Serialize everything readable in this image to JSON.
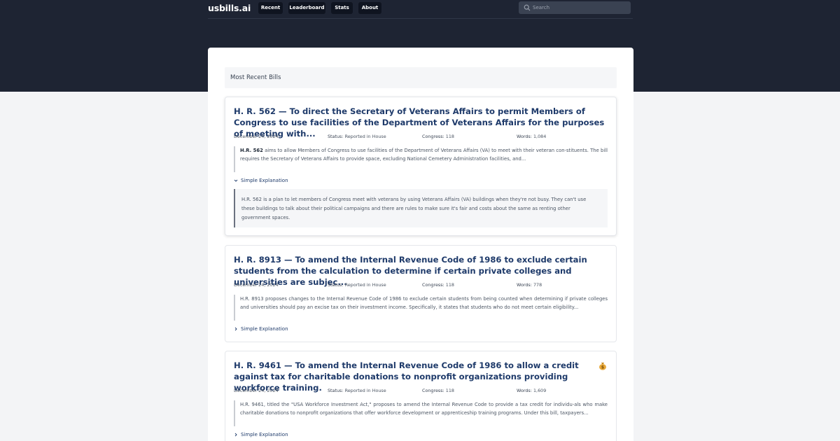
{
  "header": {
    "brand": "usbills.ai",
    "nav": [
      {
        "label": "Recent"
      },
      {
        "label": "Leaderboard"
      },
      {
        "label": "Stats"
      },
      {
        "label": "About"
      }
    ],
    "search_placeholder": "Search"
  },
  "main": {
    "section_title": "Most Recent Bills",
    "bills": [
      {
        "title": "H. R. 562 — To direct the Secretary of Veterans Affairs to permit Members of Congress to use facilities of the Department of Veterans Affairs for the purposes of meeting with...",
        "date": "December 24, 2024",
        "status_label": "Status:",
        "status": "Reported in House",
        "congress_label": "Congress:",
        "congress": "118",
        "words_label": "Words:",
        "words": "1,084",
        "summary_lead": "H.R. 562",
        "summary_rest": " aims to allow Members of Congress to use facilities of the Department of Veterans Affairs (VA) to meet with their veteran con-stituents. The bill requires the Secretary of Veterans Affairs to provide space, excluding National Cemetery Administration facilities, and...",
        "toggle_label": "Simple Explanation",
        "expanded": true,
        "explanation": "H.R. 562 is a plan to let members of Congress meet with veterans by using Veterans Affairs (VA) buildings when they're not busy. They can't use these buildings to talk about their political campaigns and there are rules to make sure it's fair and costs about the same as renting other government spaces."
      },
      {
        "title": "H. R. 8913 — To amend the Internal Revenue Code of 1986 to exclude certain students from the calculation to determine if certain private colleges and universities are subjec...",
        "date": "December 24, 2024",
        "status_label": "Status:",
        "status": "Reported in House",
        "congress_label": "Congress:",
        "congress": "118",
        "words_label": "Words:",
        "words": "778",
        "summary_lead": "",
        "summary_rest": "H.R. 8913 proposes changes to the Internal Revenue Code of 1986 to exclude certain students from being counted when determining if private colleges and universities should pay an excise tax on their investment income. Specifically, it states that students who do not meet certain eligibility...",
        "toggle_label": "Simple Explanation",
        "expanded": false
      },
      {
        "title": "H. R. 9461 — To amend the Internal Revenue Code of 1986 to allow a credit against tax for charitable donations to nonprofit organizations providing workforce training.",
        "date": "December 24, 2024",
        "status_label": "Status:",
        "status": "Reported in House",
        "congress_label": "Congress:",
        "congress": "118",
        "words_label": "Words:",
        "words": "1,609",
        "summary_lead": "",
        "summary_rest": "H.R. 9461, titled the \"USA Workforce Investment Act,\" proposes to amend the Internal Revenue Code to provide a tax credit for individu-als who make charitable donations to nonprofit organizations that offer workforce development or apprenticeship training programs. Under this bill, taxpayers...",
        "toggle_label": "Simple Explanation",
        "expanded": false,
        "icon": "money-bag-icon"
      }
    ]
  },
  "colors": {
    "hero_bg": "#1e2433",
    "nav_button_bg": "#0f1420",
    "title_blue": "#1e3a6a",
    "page_bg": "#f3f4f6"
  }
}
